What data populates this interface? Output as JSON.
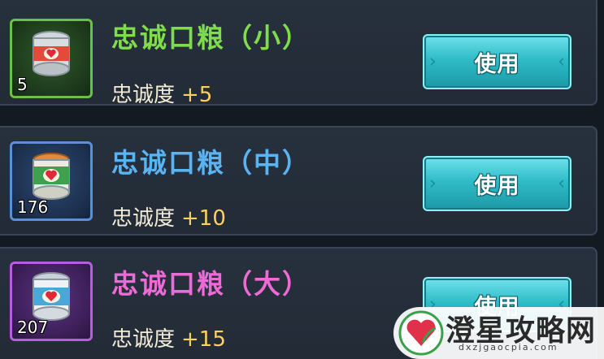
{
  "items": [
    {
      "name": "忠诚口粮（小）",
      "count": "5",
      "stat_label": "忠诚度",
      "stat_value": "+5",
      "button_label": "使用",
      "rarity_color": "#6cc04a",
      "icon": "canned-food-small-icon"
    },
    {
      "name": "忠诚口粮（中）",
      "count": "176",
      "stat_label": "忠诚度",
      "stat_value": "+10",
      "button_label": "使用",
      "rarity_color": "#5b8fd6",
      "icon": "canned-food-medium-icon"
    },
    {
      "name": "忠诚口粮（大）",
      "count": "207",
      "stat_label": "忠诚度",
      "stat_value": "+15",
      "button_label": "使用",
      "rarity_color": "#b45ee0",
      "icon": "canned-food-large-icon"
    }
  ],
  "watermark": {
    "title": "澄星攻略网",
    "url": "dxzjgaocpia.com",
    "logo": "heart-logo-icon"
  }
}
